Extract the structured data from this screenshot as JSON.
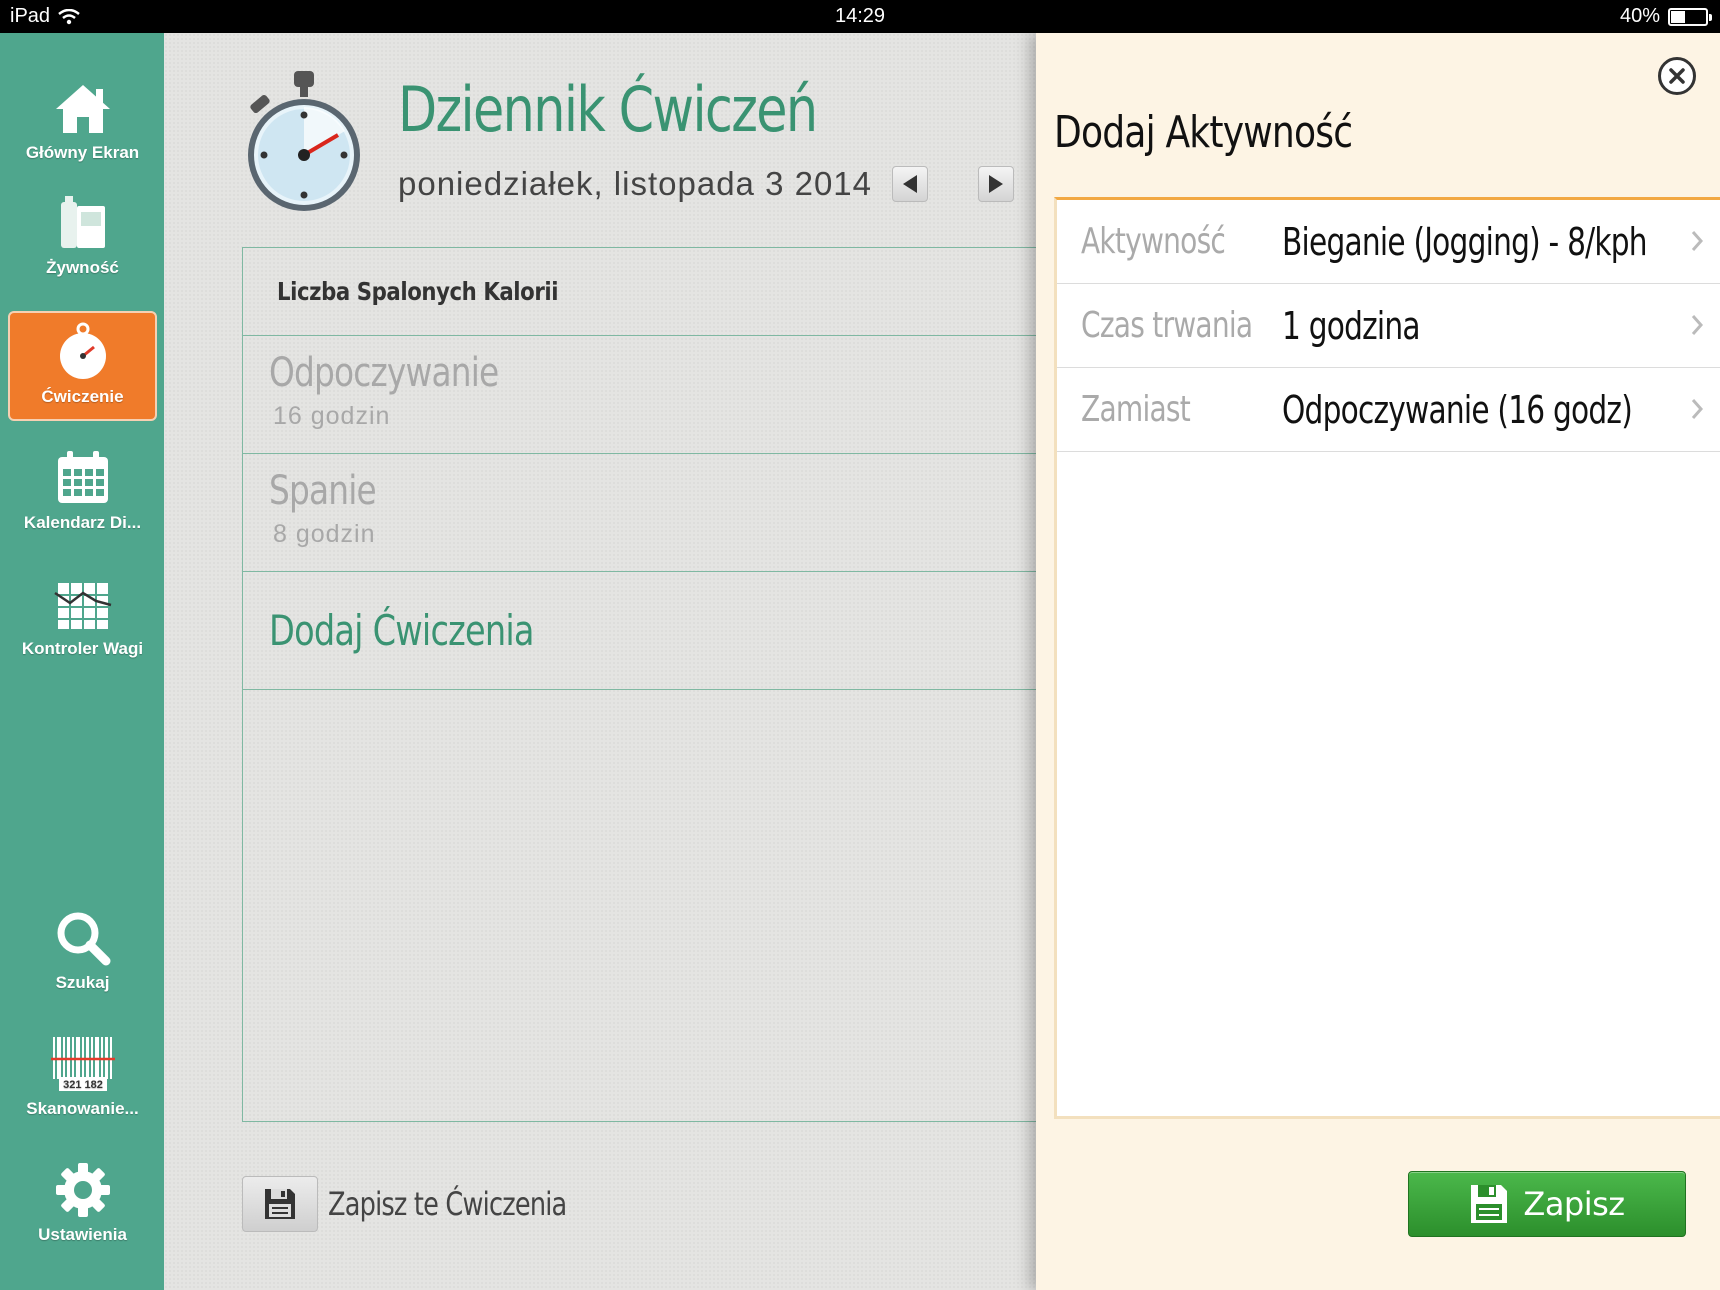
{
  "status_bar": {
    "device": "iPad",
    "time": "14:29",
    "battery_text": "40%",
    "battery_level": 0.4
  },
  "sidebar": {
    "items": [
      {
        "label": "Główny Ekran",
        "icon": "home-icon"
      },
      {
        "label": "Żywność",
        "icon": "food-icon"
      },
      {
        "label": "Ćwiczenie",
        "icon": "stopwatch-icon",
        "active": true
      },
      {
        "label": "Kalendarz Di...",
        "icon": "calendar-icon"
      },
      {
        "label": "Kontroler Wagi",
        "icon": "weight-chart-icon"
      },
      {
        "label": "Szukaj",
        "icon": "search-icon"
      },
      {
        "label": "Skanowanie...",
        "icon": "barcode-icon",
        "barcode_text": "321 182"
      },
      {
        "label": "Ustawienia",
        "icon": "gear-icon"
      }
    ]
  },
  "main": {
    "title": "Dziennik Ćwiczeń",
    "date": "poniedziałek, listopada 3 2014",
    "log_header": "Liczba Spalonych Kalorii",
    "entries": [
      {
        "title": "Odpoczywanie",
        "subtitle": "16 godzin"
      },
      {
        "title": "Spanie",
        "subtitle": "8 godzin"
      }
    ],
    "add_exercise": "Dodaj Ćwiczenia",
    "save_log": "Zapisz te Ćwiczenia"
  },
  "panel": {
    "title": "Dodaj Aktywność",
    "rows": [
      {
        "label": "Aktywność",
        "value": "Bieganie (Jogging) - 8/kph"
      },
      {
        "label": "Czas trwania",
        "value": "1 godzina"
      },
      {
        "label": "Zamiast",
        "value": "Odpoczywanie (16 godz)"
      }
    ],
    "save_button": "Zapisz"
  },
  "colors": {
    "sidebar_bg": "#4fa68d",
    "active_nav": "#f07b2a",
    "title_green": "#3a9372",
    "panel_bg": "#fdf4e4",
    "save_green": "#3aa33a",
    "form_border": "#f2a842"
  }
}
